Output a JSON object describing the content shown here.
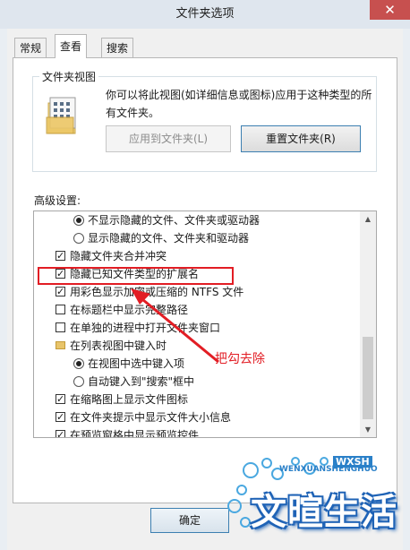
{
  "window": {
    "title": "文件夹选项",
    "close_glyph": "✕"
  },
  "tabs": [
    {
      "label": "常规"
    },
    {
      "label": "查看"
    },
    {
      "label": "搜索"
    }
  ],
  "folder_view": {
    "legend": "文件夹视图",
    "description": "你可以将此视图(如详细信息或图标)应用于这种类型的所有文件夹。",
    "apply_button": "应用到文件夹(L)",
    "reset_button": "重置文件夹(R)"
  },
  "advanced": {
    "label": "高级设置:",
    "items": [
      {
        "text": "不显示隐藏的文件、文件夹或驱动器"
      },
      {
        "text": "显示隐藏的文件、文件夹和驱动器"
      },
      {
        "text": "隐藏文件夹合并冲突"
      },
      {
        "text": "隐藏已知文件类型的扩展名"
      },
      {
        "text": "用彩色显示加密或压缩的 NTFS 文件"
      },
      {
        "text": "在标题栏中显示完整路径"
      },
      {
        "text": "在单独的进程中打开文件夹窗口"
      },
      {
        "text": "在列表视图中键入时"
      },
      {
        "text": "在视图中选中键入项"
      },
      {
        "text": "自动键入到\"搜索\"框中"
      },
      {
        "text": "在缩略图上显示文件图标"
      },
      {
        "text": "在文件夹提示中显示文件大小信息"
      },
      {
        "text": "在预览窗格中显示预览控件"
      }
    ]
  },
  "annotation": {
    "text": "把勾去除",
    "color": "#e21d24"
  },
  "watermark": {
    "text": "文暄生活",
    "subtitle": "WENXUANSHENGHUO",
    "badge": "WXSH"
  },
  "ok_button": "确定"
}
